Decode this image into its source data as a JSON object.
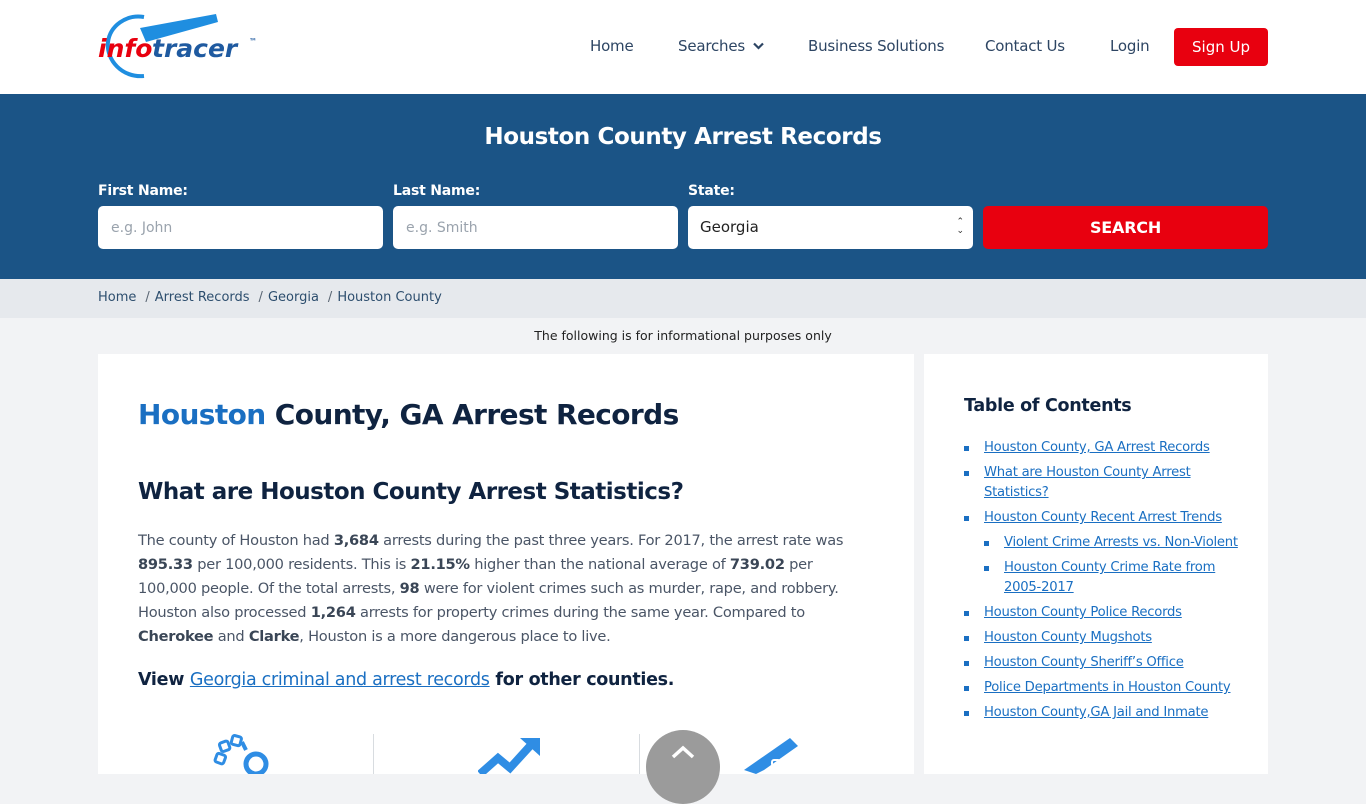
{
  "brand": {
    "logo_left": "info",
    "logo_right": "tracer",
    "trademark": "™",
    "logo_red": "#e8000f",
    "logo_blue": "#1f5aa0",
    "accent_blue": "#1a6fc2"
  },
  "nav": {
    "items": [
      {
        "label": "Home"
      },
      {
        "label": "Searches",
        "has_dropdown": true
      },
      {
        "label": "Business Solutions"
      },
      {
        "label": "Contact Us"
      },
      {
        "label": "Login"
      }
    ],
    "signup_label": "Sign Up"
  },
  "hero": {
    "title": "Houston County Arrest Records",
    "first_name": {
      "label": "First Name:",
      "placeholder": "e.g. John",
      "value": ""
    },
    "last_name": {
      "label": "Last Name:",
      "placeholder": "e.g. Smith",
      "value": ""
    },
    "state": {
      "label": "State:",
      "value": "Georgia"
    },
    "search_label": "SEARCH"
  },
  "breadcrumb": {
    "items": [
      "Home",
      "Arrest Records",
      "Georgia"
    ],
    "current": "Houston County",
    "separator": "/"
  },
  "info_note": "The following is for informational purposes only",
  "main": {
    "title_accent": "Houston",
    "title_rest": " County, GA Arrest Records",
    "stats_heading": "What are Houston County Arrest Statistics?",
    "paragraph": {
      "t1": "The county of Houston had ",
      "b1": "3,684",
      "t2": " arrests during the past three years. For 2017, the arrest rate was ",
      "b2": "895.33",
      "t3": " per 100,000 residents. This is ",
      "b3": "21.15%",
      "t4": " higher than the national average of ",
      "b4": "739.02",
      "t5": " per 100,000 people. Of the total arrests, ",
      "b5": "98",
      "t6": " were for violent crimes such as murder, rape, and robbery. Houston also processed ",
      "b6": "1,264",
      "t7": " arrests for property crimes during the same year. Compared to ",
      "b7": "Cherokee",
      "t8": " and ",
      "b8": "Clarke",
      "t9": ", Houston is a more dangerous place to live."
    },
    "view_prefix": "View ",
    "view_link": "Georgia criminal and arrest records",
    "view_suffix": " for other counties.",
    "stat_icons": [
      "handcuffs-icon",
      "trend-up-icon",
      "handgun-icon"
    ]
  },
  "toc": {
    "title": "Table of Contents",
    "items": [
      {
        "label": "Houston County, GA Arrest Records",
        "level": 1
      },
      {
        "label": "What are Houston County Arrest Statistics?",
        "level": 1
      },
      {
        "label": "Houston County Recent Arrest Trends",
        "level": 1
      },
      {
        "label": "Violent Crime Arrests vs. Non-Violent",
        "level": 2
      },
      {
        "label": "Houston County Crime Rate from 2005-2017",
        "level": 2
      },
      {
        "label": "Houston County Police Records",
        "level": 1
      },
      {
        "label": "Houston County Mugshots",
        "level": 1
      },
      {
        "label": "Houston County Sheriff’s Office",
        "level": 1
      },
      {
        "label": "Police Departments in Houston County",
        "level": 1
      },
      {
        "label": "Houston County,GA Jail and Inmate",
        "level": 1
      }
    ]
  }
}
